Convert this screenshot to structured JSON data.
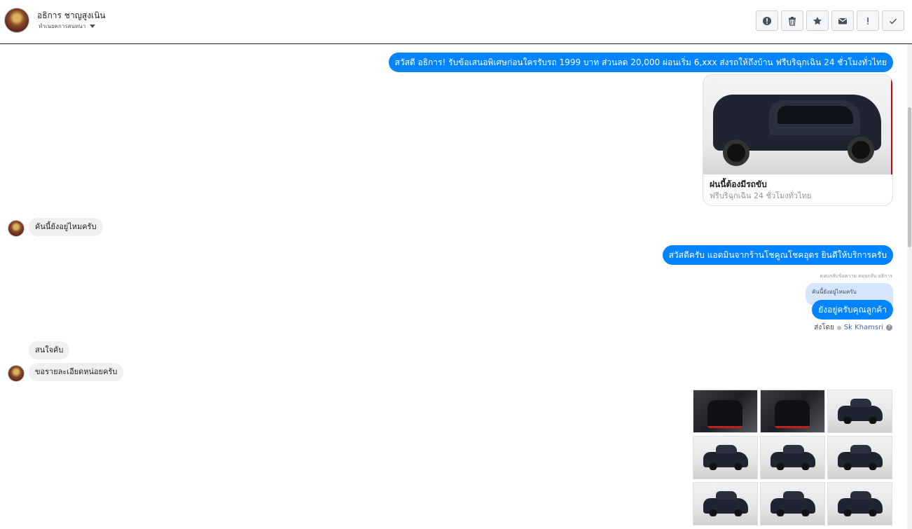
{
  "header": {
    "name": "อธิการ ชาญสูงเนิน",
    "sub": "ทำเนยคการสนทนา",
    "toolbar": [
      {
        "name": "report-icon",
        "label": "report"
      },
      {
        "name": "trash-icon",
        "label": "delete"
      },
      {
        "name": "star-icon",
        "label": "star"
      },
      {
        "name": "mail-icon",
        "label": "mark-unread"
      },
      {
        "name": "exclamation-icon",
        "label": "spam"
      },
      {
        "name": "check-icon",
        "label": "done"
      }
    ]
  },
  "messages": {
    "out1": "สวัสดี อธิการ! รับข้อเสนอพิเศษก่อนใครรับรถ 1999 บาท ส่วนลด 20,000  ผ่อนเริ่ม 6,xxx ส่งรถให้ถึงบ้าน ฟรีบริฉุกเฉิน 24 ชั่วโมงทั่วไทย",
    "card_title": "ฝนนี้ต้องมีรถขับ",
    "card_sub": "ฟรีบริฉุกเฉิน 24 ชั่วโมงทั่วไทย",
    "in1": "คันนี้ยังอยู่ไหมครับ",
    "out2": "สวัสดีครับ แอดมินจากร้านโชคูณโชคอุดร ยินดีให้บริการครับ",
    "reply_meta": "ตอบกลับข้อความ ตอบกลับ อธิการ",
    "reply_quote": "คันนี้ยังอยู่ไหมครับ",
    "out3": "ยังอยู่ครับคุณลูกค้า",
    "sent_by_label": "ส่งโดย",
    "sent_by_agent": "Sk Khamsri",
    "help": "?",
    "in2": "สนใจคับ",
    "in3": "ขอรายละเอียดหน่อยครับ"
  },
  "photos": [
    "interior-front",
    "interior-rear",
    "exterior",
    "exterior",
    "exterior",
    "exterior",
    "exterior",
    "exterior",
    "exterior"
  ],
  "colors": {
    "accent": "#0084ff",
    "incoming": "#f1f0f0",
    "quote": "#d5e5fb"
  }
}
